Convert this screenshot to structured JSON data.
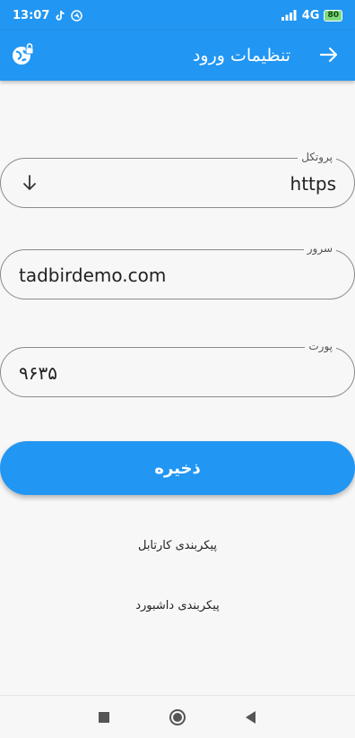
{
  "status_bar": {
    "time": "13:07",
    "network": "4G",
    "battery": "80",
    "icons": [
      "tiktok-icon",
      "at-sign-icon",
      "signal-icon",
      "battery-icon"
    ]
  },
  "app_bar": {
    "title": "تنظیمات ورود",
    "back_icon": "arrow-right-icon",
    "action_icon": "globe-lock-icon"
  },
  "form": {
    "protocol": {
      "label": "پروتکل",
      "value": "https"
    },
    "server": {
      "label": "سرور",
      "value": "tadbirdemo.com"
    },
    "port": {
      "label": "پورت",
      "value": "۹۶۳۵"
    }
  },
  "save_button": {
    "label": "ذخیره"
  },
  "links": {
    "cartable_config": "پیکربندی کارتابل",
    "dashboard_config": "پیکربندی داشبورد"
  },
  "colors": {
    "primary": "#2196f3",
    "background": "#f7f7f7"
  }
}
